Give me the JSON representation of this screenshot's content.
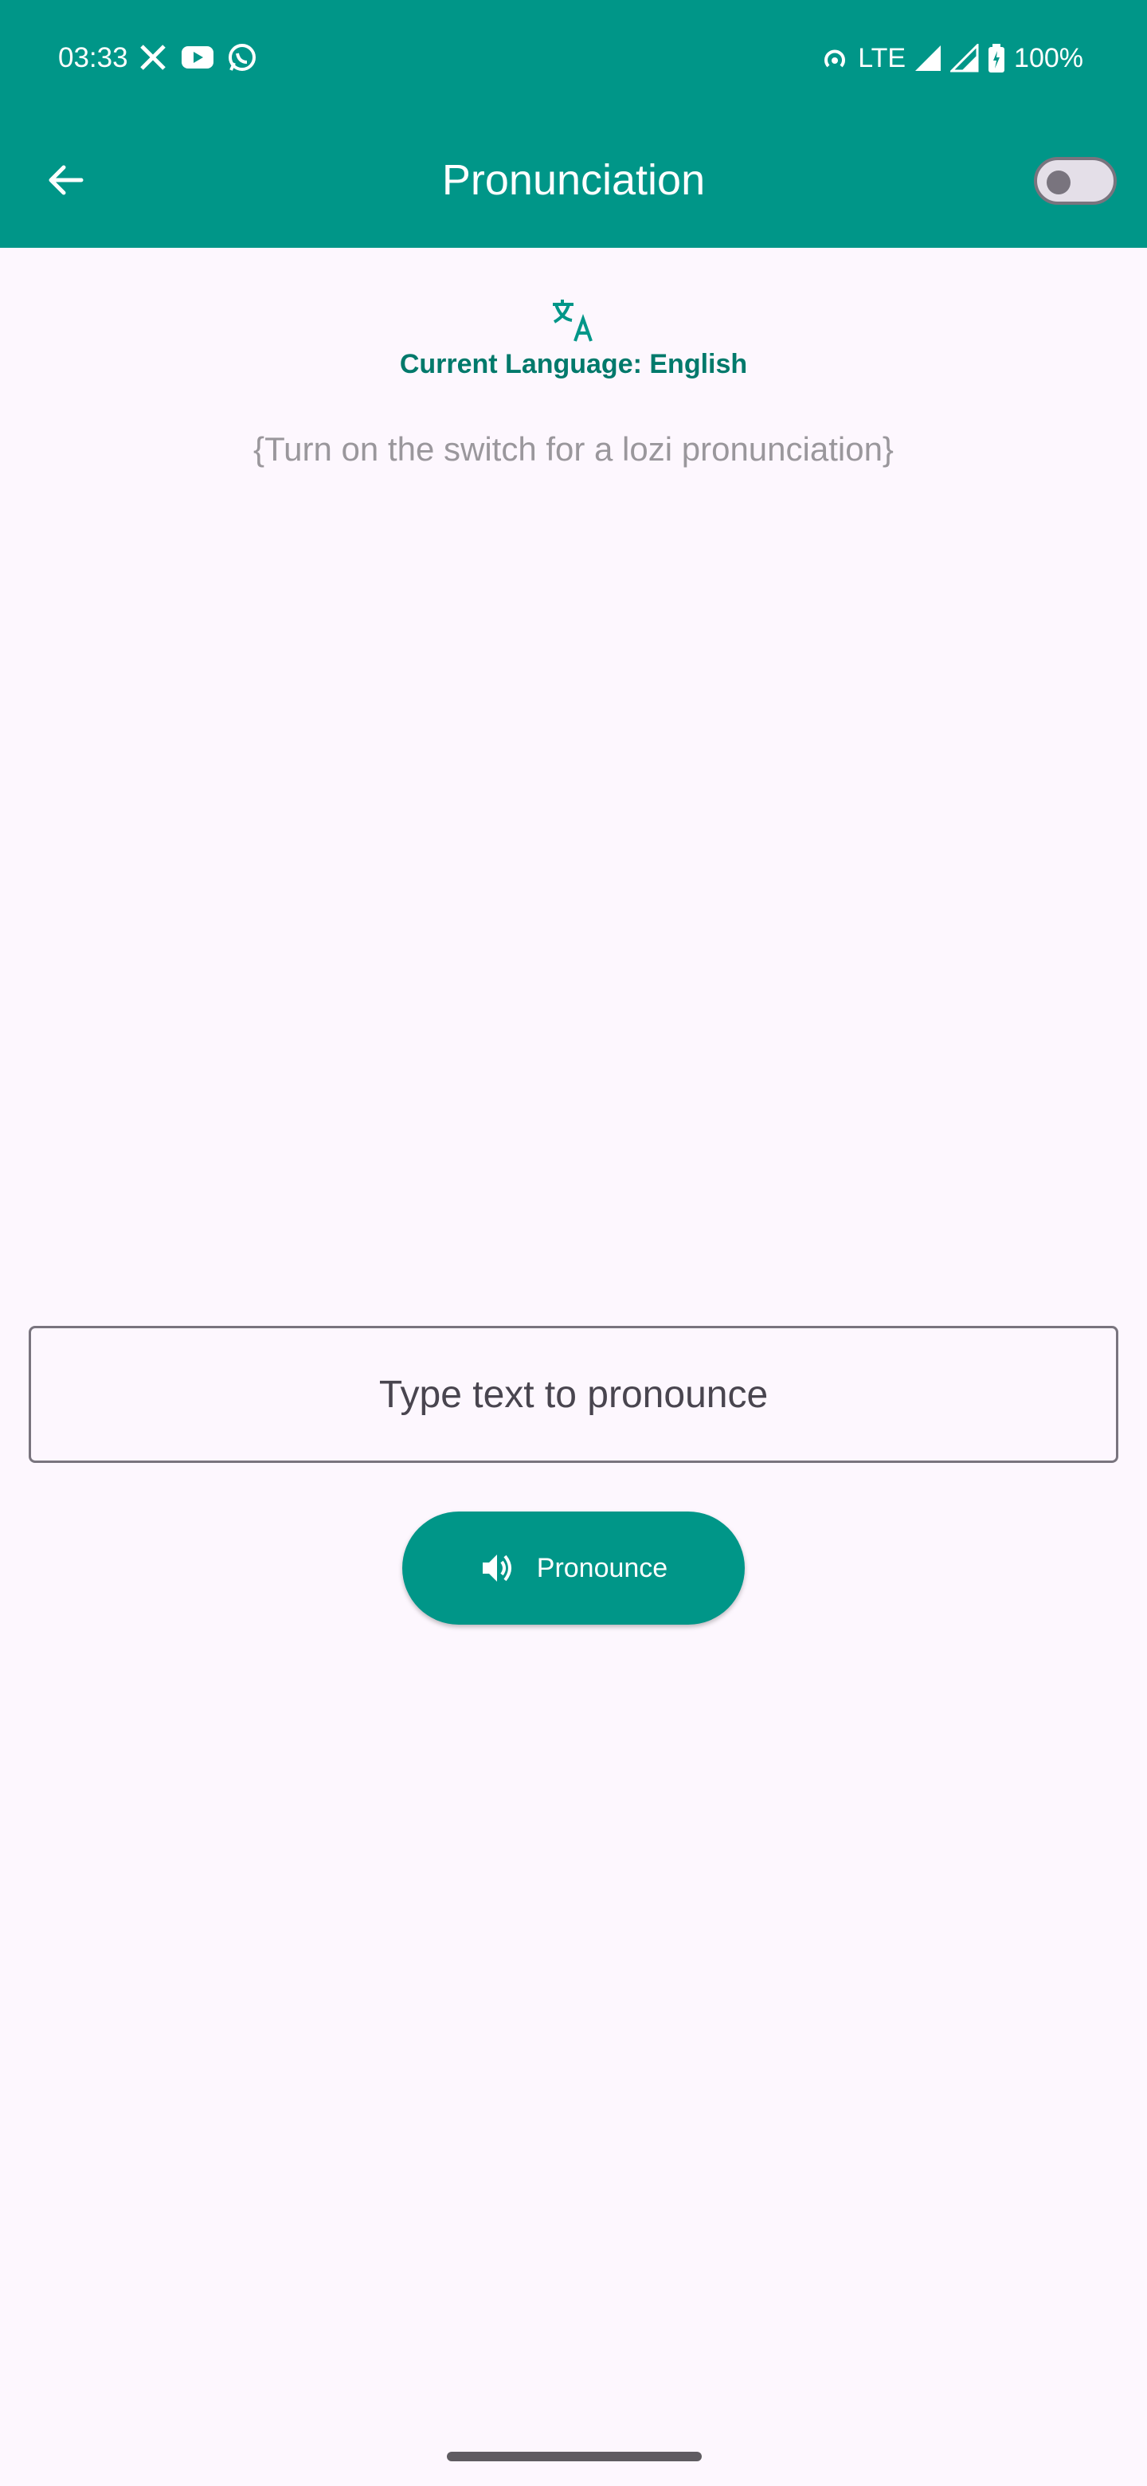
{
  "status_bar": {
    "time": "03:33",
    "left_icons": [
      "x-icon",
      "youtube-icon",
      "whatsapp-icon"
    ],
    "network": "LTE",
    "battery": "100%"
  },
  "app_bar": {
    "title": "Pronunciation",
    "background_color": "#009688",
    "switch_state": "off"
  },
  "main": {
    "language_label": "Current Language: English",
    "hint": "{Turn on the switch for a lozi pronunciation}",
    "input_placeholder": "Type text to pronounce",
    "input_value": "",
    "pronounce_button_label": "Pronounce"
  },
  "colors": {
    "accent": "#009688",
    "accent_dark": "#00796b",
    "background": "#fdf7fe"
  }
}
